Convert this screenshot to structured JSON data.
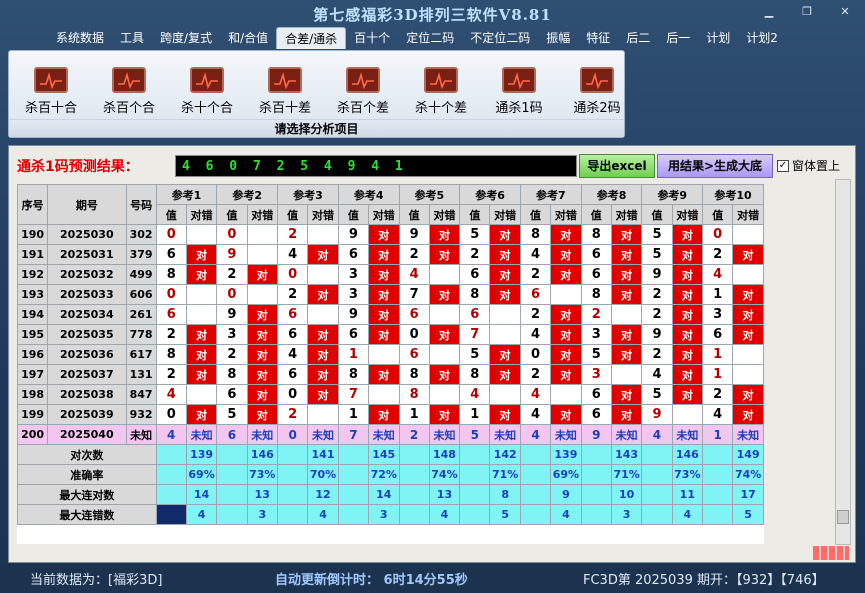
{
  "window": {
    "title": "第七感福彩3D排列三软件V8.81"
  },
  "menu": [
    "系统数据",
    "工具",
    "跨度/复式",
    "和/合值",
    "合差/通杀",
    "百十个",
    "定位二码",
    "不定位二码",
    "振幅",
    "特征",
    "后二",
    "后一",
    "计划",
    "计划2"
  ],
  "menu_active": 4,
  "toolbar": {
    "tools": [
      "杀百十合",
      "杀百个合",
      "杀十个合",
      "杀百十差",
      "杀百个差",
      "杀十个差",
      "通杀1码",
      "通杀2码"
    ],
    "caption": "请选择分析项目"
  },
  "result": {
    "label": "通杀1码预测结果：",
    "digits": "4 6 0 7 2 5 4 9 4 1",
    "export_label": "导出excel",
    "tobig_label": "用结果>生成大底",
    "ontop_label": "窗体置上",
    "ontop_checked": true
  },
  "table": {
    "header_seq": "序号",
    "header_period": "期号",
    "header_number": "号码",
    "refs": [
      "参考1",
      "参考2",
      "参考3",
      "参考4",
      "参考5",
      "参考6",
      "参考7",
      "参考8",
      "参考9",
      "参考10"
    ],
    "sub_val": "值",
    "sub_hit": "对错",
    "hit_text": "对",
    "rows": [
      {
        "seq": "190",
        "period": "2025030",
        "num": "302",
        "vals": [
          "0",
          "0",
          "2",
          "9",
          "9",
          "5",
          "8",
          "8",
          "5",
          "0"
        ],
        "hits": [
          0,
          0,
          0,
          1,
          1,
          1,
          1,
          1,
          1,
          0
        ]
      },
      {
        "seq": "191",
        "period": "2025031",
        "num": "379",
        "vals": [
          "6",
          "9",
          "4",
          "6",
          "2",
          "2",
          "4",
          "6",
          "5",
          "2"
        ],
        "hits": [
          1,
          0,
          1,
          1,
          1,
          1,
          1,
          1,
          1,
          1
        ]
      },
      {
        "seq": "192",
        "period": "2025032",
        "num": "499",
        "vals": [
          "8",
          "2",
          "0",
          "3",
          "4",
          "6",
          "2",
          "6",
          "9",
          "4"
        ],
        "hits": [
          1,
          1,
          0,
          1,
          0,
          1,
          1,
          1,
          1,
          0
        ]
      },
      {
        "seq": "193",
        "period": "2025033",
        "num": "606",
        "vals": [
          "0",
          "0",
          "2",
          "3",
          "7",
          "8",
          "6",
          "8",
          "2",
          "1"
        ],
        "hits": [
          0,
          0,
          1,
          1,
          1,
          1,
          0,
          1,
          1,
          1
        ]
      },
      {
        "seq": "194",
        "period": "2025034",
        "num": "261",
        "vals": [
          "6",
          "9",
          "6",
          "9",
          "6",
          "6",
          "2",
          "2",
          "2",
          "3"
        ],
        "hits": [
          0,
          1,
          0,
          1,
          0,
          0,
          1,
          0,
          1,
          1
        ]
      },
      {
        "seq": "195",
        "period": "2025035",
        "num": "778",
        "vals": [
          "2",
          "3",
          "6",
          "6",
          "0",
          "7",
          "4",
          "3",
          "9",
          "6"
        ],
        "hits": [
          1,
          1,
          1,
          1,
          1,
          0,
          1,
          1,
          1,
          1
        ]
      },
      {
        "seq": "196",
        "period": "2025036",
        "num": "617",
        "vals": [
          "8",
          "2",
          "4",
          "1",
          "6",
          "5",
          "0",
          "5",
          "2",
          "1"
        ],
        "hits": [
          1,
          1,
          1,
          0,
          0,
          1,
          1,
          1,
          1,
          0
        ]
      },
      {
        "seq": "197",
        "period": "2025037",
        "num": "131",
        "vals": [
          "2",
          "8",
          "6",
          "8",
          "8",
          "8",
          "2",
          "3",
          "4",
          "1"
        ],
        "hits": [
          1,
          1,
          1,
          1,
          1,
          1,
          1,
          0,
          1,
          0
        ]
      },
      {
        "seq": "198",
        "period": "2025038",
        "num": "847",
        "vals": [
          "4",
          "6",
          "0",
          "7",
          "8",
          "4",
          "4",
          "6",
          "5",
          "2"
        ],
        "hits": [
          0,
          1,
          1,
          0,
          0,
          0,
          0,
          1,
          1,
          1
        ]
      },
      {
        "seq": "199",
        "period": "2025039",
        "num": "932",
        "vals": [
          "0",
          "5",
          "2",
          "1",
          "1",
          "1",
          "4",
          "6",
          "9",
          "4"
        ],
        "hits": [
          1,
          1,
          0,
          1,
          1,
          1,
          1,
          1,
          0,
          1
        ]
      }
    ],
    "pending": {
      "seq": "200",
      "period": "2025040",
      "num": "未知",
      "vals": [
        "4",
        "6",
        "0",
        "7",
        "2",
        "5",
        "4",
        "9",
        "4",
        "1"
      ],
      "unknown": "未知"
    },
    "stats": [
      {
        "label": "对次数",
        "values": [
          "139",
          "146",
          "141",
          "145",
          "148",
          "142",
          "139",
          "143",
          "146",
          "149"
        ]
      },
      {
        "label": "准确率",
        "values": [
          "69%",
          "73%",
          "70%",
          "72%",
          "74%",
          "71%",
          "69%",
          "71%",
          "73%",
          "74%"
        ]
      },
      {
        "label": "最大连对数",
        "values": [
          "14",
          "13",
          "12",
          "14",
          "13",
          "8",
          "9",
          "10",
          "11",
          "17"
        ]
      },
      {
        "label": "最大连错数",
        "values": [
          "4",
          "3",
          "4",
          "3",
          "4",
          "5",
          "4",
          "3",
          "4",
          "5"
        ]
      }
    ]
  },
  "status": {
    "current_data": "当前数据为：[福彩3D]",
    "countdown": "自动更新倒计时：  6时14分55秒",
    "draw": "FC3D第 2025039 期开：【932】【746】"
  }
}
